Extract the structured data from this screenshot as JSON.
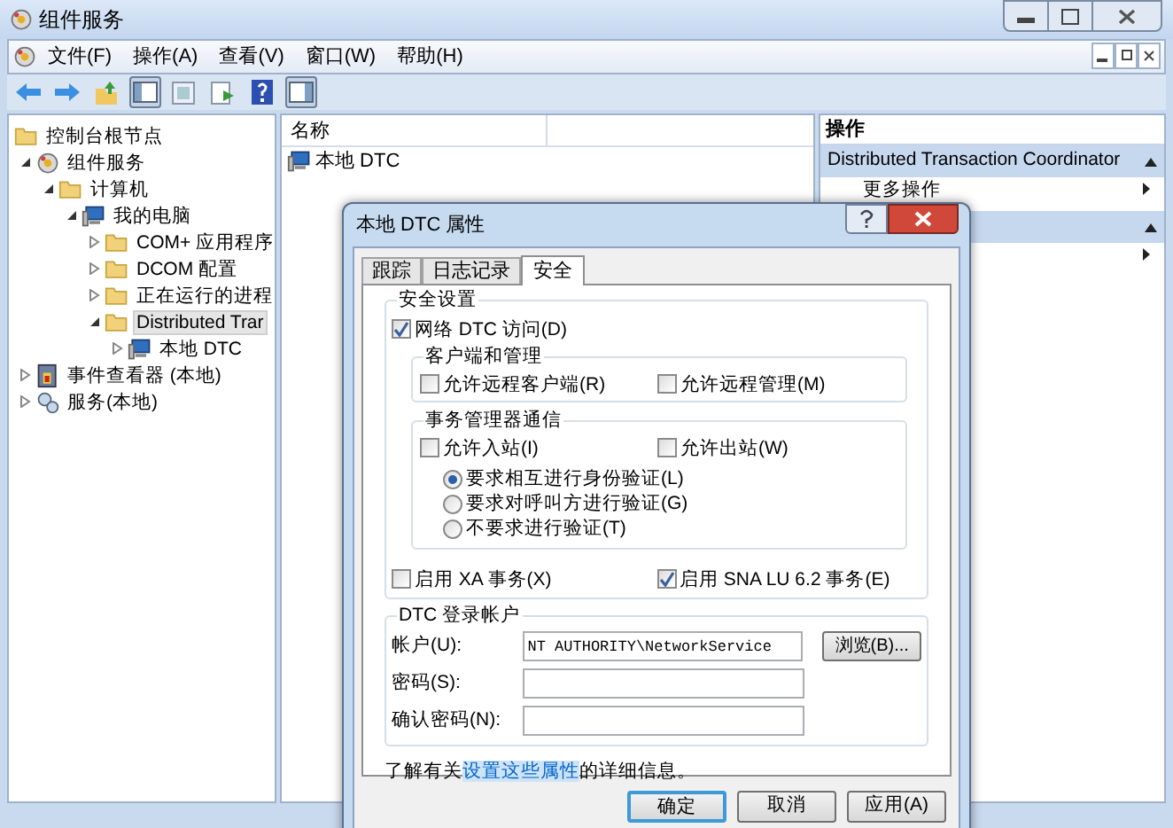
{
  "window": {
    "title": "组件服务"
  },
  "menu": [
    "文件(F)",
    "操作(A)",
    "查看(V)",
    "窗口(W)",
    "帮助(H)"
  ],
  "tree": [
    {
      "label": "控制台根节点",
      "kind": "folder",
      "selected": false,
      "children": [
        {
          "label": "组件服务",
          "kind": "component",
          "expanded": true,
          "selected": false,
          "children": [
            {
              "label": "计算机",
              "kind": "folder",
              "expanded": true,
              "selected": false,
              "children": [
                {
                  "label": "我的电脑",
                  "kind": "computer",
                  "expanded": true,
                  "selected": false,
                  "children": [
                    {
                      "label": "COM+ 应用程序",
                      "kind": "folder",
                      "expanded": false,
                      "selected": false
                    },
                    {
                      "label": "DCOM 配置",
                      "kind": "folder",
                      "expanded": false,
                      "selected": false
                    },
                    {
                      "label": "正在运行的进程",
                      "kind": "folder",
                      "expanded": false,
                      "selected": false
                    },
                    {
                      "label": "Distributed Trar",
                      "kind": "folder",
                      "expanded": true,
                      "selected": true,
                      "children": [
                        {
                          "label": "本地 DTC",
                          "kind": "computer",
                          "expanded": false,
                          "selected": false
                        }
                      ]
                    }
                  ]
                }
              ]
            }
          ]
        },
        {
          "label": "事件查看器 (本地)",
          "kind": "eventlog",
          "expanded": false,
          "selected": false
        },
        {
          "label": "服务(本地)",
          "kind": "services",
          "expanded": false,
          "selected": false
        }
      ]
    }
  ],
  "list": {
    "columns": [
      "名称"
    ],
    "rows": [
      {
        "label": "本地 DTC",
        "kind": "computer"
      }
    ]
  },
  "actions": {
    "header": "操作",
    "sections": [
      {
        "title": "Distributed Transaction Coordinator",
        "expanded": true,
        "items": [
          {
            "label": "更多操作",
            "has_submenu": true
          }
        ]
      },
      {
        "expanded": true,
        "items": [
          {
            "has_submenu": true
          }
        ]
      }
    ]
  },
  "dialog": {
    "title": "本地 DTC 属性",
    "tabs": [
      {
        "label": "跟踪",
        "selected": false
      },
      {
        "label": "日志记录",
        "selected": false
      },
      {
        "label": "安全",
        "selected": true
      }
    ],
    "security_group": "安全设置",
    "network_access": {
      "label": "网络 DTC 访问(D)",
      "checked": true
    },
    "client_admin": {
      "title": "客户端和管理",
      "options": [
        {
          "label": "允许远程客户端(R)",
          "checked": false
        },
        {
          "label": "允许远程管理(M)",
          "checked": false
        }
      ]
    },
    "tm_comm": {
      "title": "事务管理器通信",
      "options": [
        {
          "label": "允许入站(I)",
          "checked": false
        },
        {
          "label": "允许出站(W)",
          "checked": false
        }
      ],
      "auth": [
        {
          "label": "要求相互进行身份验证(L)",
          "selected": true
        },
        {
          "label": "要求对呼叫方进行验证(G)",
          "selected": false
        },
        {
          "label": "不要求进行验证(T)",
          "selected": false
        }
      ]
    },
    "transactions": [
      {
        "label": "启用 XA 事务(X)",
        "checked": false
      },
      {
        "label": "启用 SNA LU 6.2 事务(E)",
        "checked": true
      }
    ],
    "logon": {
      "title": "DTC 登录帐户",
      "fields": [
        {
          "label": "帐户(U):",
          "value": "NT AUTHORITY\\NetworkService"
        },
        {
          "label": "密码(S):"
        },
        {
          "label": "确认密码(N):"
        }
      ],
      "browse": "浏览(B)..."
    },
    "info": {
      "before": "了解有关",
      "link": "设置这些属性",
      "after": "的详细信息。"
    },
    "buttons": [
      {
        "label": "确定",
        "default": true
      },
      {
        "label": "取消",
        "default": false
      },
      {
        "label": "应用(A)",
        "default": false
      }
    ]
  }
}
